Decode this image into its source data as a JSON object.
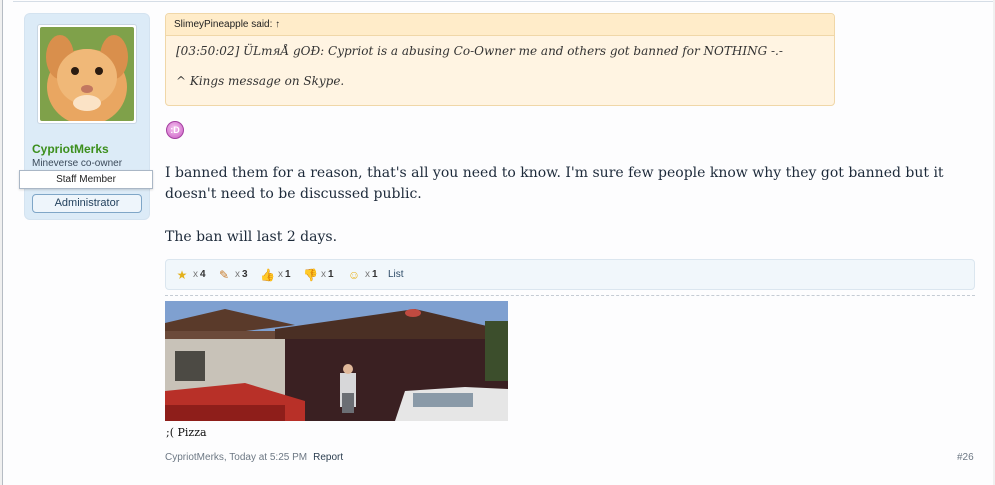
{
  "user": {
    "name": "CypriotMerks",
    "title": "Mineverse co-owner",
    "staff_label": "Staff Member",
    "role_label": "Administrator"
  },
  "quote": {
    "author": "SlimeyPineapple said:",
    "arrow": "↑",
    "lines": [
      "[03:50:02] ÜLmяÅ gOÐ: Cypriot is a abusing Co-Owner me and others got banned for NOTHING -.-",
      "^ Kings message on Skype."
    ]
  },
  "message": {
    "paragraphs": [
      "I banned them for a reason, that's all you need to know. I'm sure few people know why they got banned but it doesn't need to be discussed public.",
      "The ban will last 2 days."
    ]
  },
  "ratings": {
    "items": [
      {
        "icon": "winner-icon",
        "x": "x",
        "count": "4"
      },
      {
        "icon": "paintbrush-icon",
        "x": "x",
        "count": "3"
      },
      {
        "icon": "thumbs-up-icon",
        "x": "x",
        "count": "1"
      },
      {
        "icon": "thumbs-down-icon",
        "x": "x",
        "count": "1"
      },
      {
        "icon": "funny-face-icon",
        "x": "x",
        "count": "1"
      }
    ],
    "list_label": "List"
  },
  "signature": {
    "caption": ";( Pizza"
  },
  "footer": {
    "author_time": "CypriotMerks, Today at 5:25 PM",
    "report_label": "Report",
    "post_number": "#26"
  }
}
